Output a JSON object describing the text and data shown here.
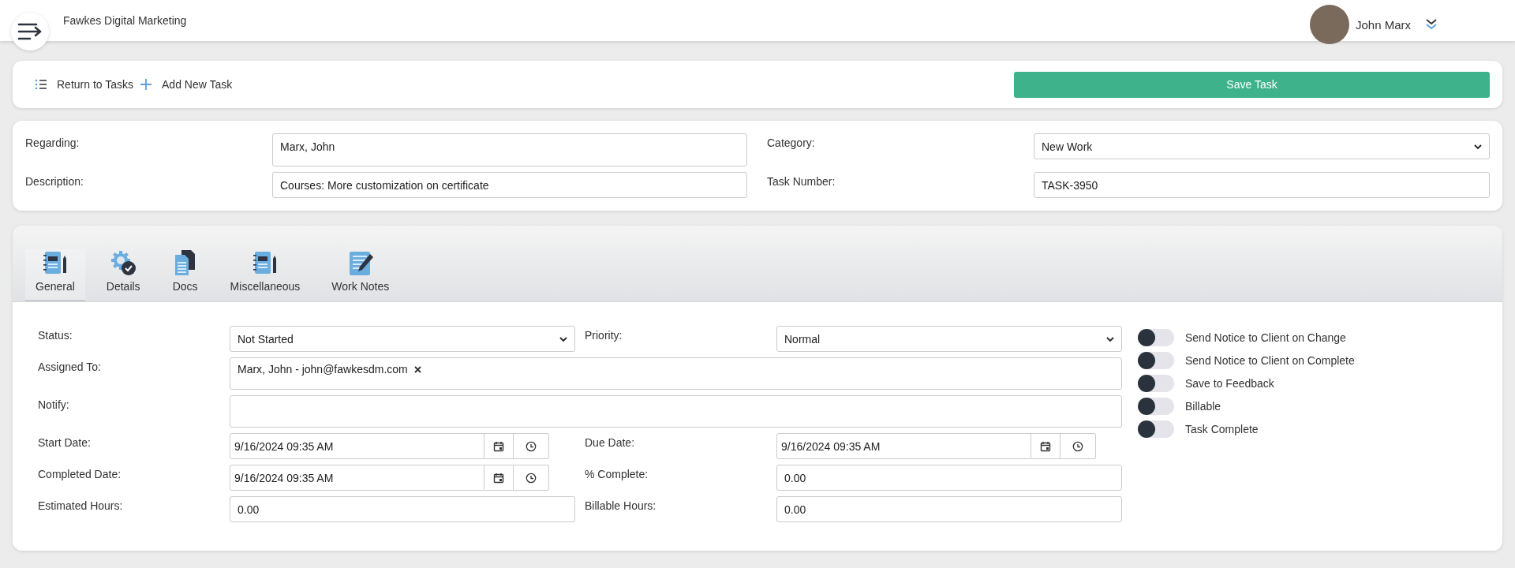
{
  "header": {
    "brand": "Fawkes Digital Marketing",
    "user": "John Marx"
  },
  "toolbar": {
    "links": [
      {
        "kind": "list",
        "label": "Return to Tasks"
      },
      {
        "kind": "add",
        "label": "Add New Task"
      }
    ],
    "save_button": "Save Task"
  },
  "summary": {
    "regarding": {
      "label": "Regarding:",
      "value": "Marx, John"
    },
    "description": {
      "label": "Description:",
      "value": "Courses: More customization on certificate"
    },
    "category": {
      "label": "Category:",
      "value": "New Work"
    },
    "task_number": {
      "label": "Task Number:",
      "value": "TASK-3950"
    }
  },
  "tabs": [
    {
      "kind": "notebook",
      "label": "General",
      "selected": true
    },
    {
      "kind": "gear",
      "label": "Details",
      "selected": false
    },
    {
      "kind": "docs",
      "label": "Docs",
      "selected": false
    },
    {
      "kind": "notebook",
      "label": "Miscellaneous",
      "selected": false
    },
    {
      "kind": "notes",
      "label": "Work Notes",
      "selected": false
    }
  ],
  "general": {
    "status": {
      "label": "Status:",
      "value": "Not Started"
    },
    "priority": {
      "label": "Priority:",
      "value": "Normal"
    },
    "assigned_to": {
      "label": "Assigned To:",
      "tags": [
        "Marx, John - john@fawkesdm.com"
      ]
    },
    "notify": {
      "label": "Notify:"
    },
    "start_date": {
      "label": "Start Date:",
      "value": "9/16/2024 09:35 AM"
    },
    "due_date": {
      "label": "Due Date:",
      "value": "9/16/2024 09:35 AM"
    },
    "completed_date": {
      "label": "Completed Date:",
      "value": "9/16/2024 09:35 AM"
    },
    "percent_complete": {
      "label": "% Complete:",
      "value": "0.00"
    },
    "estimated_hours": {
      "label": "Estimated Hours:",
      "value": "0.00"
    },
    "billable_hours": {
      "label": "Billable Hours:",
      "value": "0.00"
    }
  },
  "toggles": [
    {
      "label": "Send Notice to Client on Change",
      "checked": false
    },
    {
      "label": "Send Notice to Client on Complete",
      "checked": false
    },
    {
      "label": "Save to Feedback",
      "checked": false
    },
    {
      "label": "Billable",
      "checked": false
    },
    {
      "label": "Task Complete",
      "checked": false
    }
  ]
}
